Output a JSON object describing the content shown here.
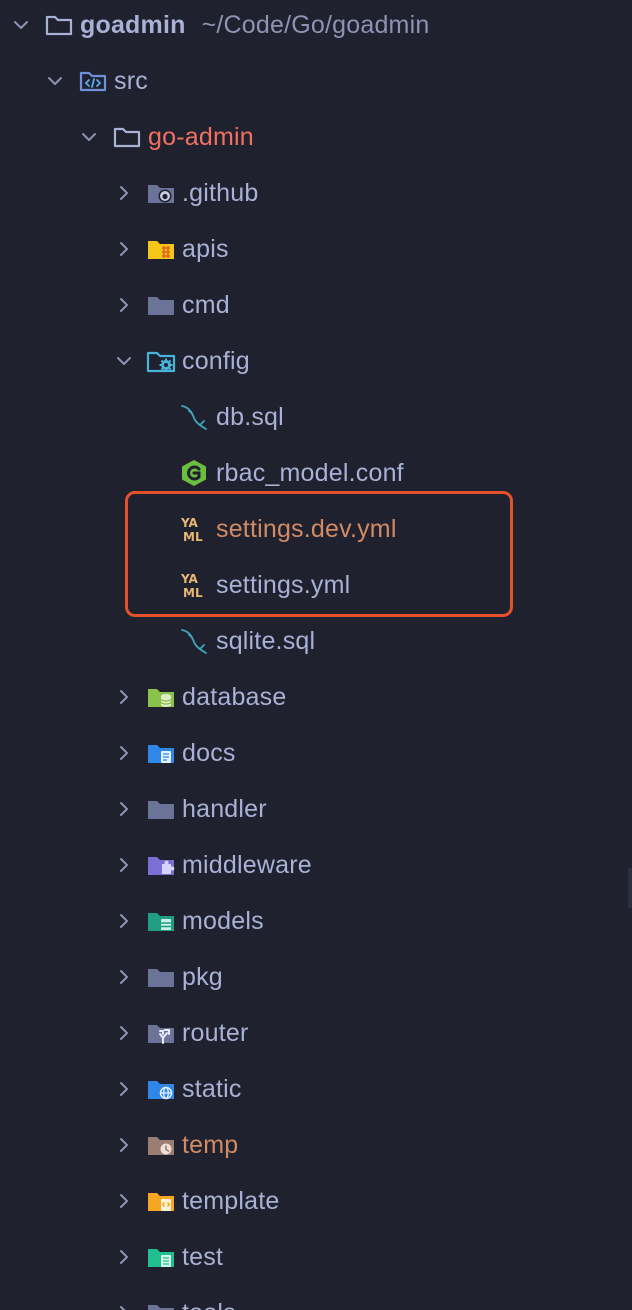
{
  "root": {
    "name": "goadmin",
    "path": "~/Code/Go/goadmin"
  },
  "src": {
    "label": "src"
  },
  "goadmin_pkg": {
    "label": "go-admin"
  },
  "folders_top": [
    {
      "label": ".github",
      "icon": "github-folder-icon"
    },
    {
      "label": "apis",
      "icon": "api-folder-icon"
    },
    {
      "label": "cmd",
      "icon": "folder-icon"
    }
  ],
  "config": {
    "label": "config",
    "files": [
      {
        "label": "db.sql",
        "icon": "mysql-dolphin-icon"
      },
      {
        "label": "rbac_model.conf",
        "icon": "go-g-icon"
      },
      {
        "label": "settings.dev.yml",
        "icon": "yaml-icon"
      },
      {
        "label": "settings.yml",
        "icon": "yaml-icon"
      },
      {
        "label": "sqlite.sql",
        "icon": "mysql-dolphin-icon"
      }
    ]
  },
  "folders_bottom": [
    {
      "label": "database",
      "icon": "database-folder-icon"
    },
    {
      "label": "docs",
      "icon": "docs-folder-icon"
    },
    {
      "label": "handler",
      "icon": "folder-icon"
    },
    {
      "label": "middleware",
      "icon": "middleware-folder-icon"
    },
    {
      "label": "models",
      "icon": "models-folder-icon"
    },
    {
      "label": "pkg",
      "icon": "folder-icon"
    },
    {
      "label": "router",
      "icon": "router-folder-icon"
    },
    {
      "label": "static",
      "icon": "static-folder-icon"
    },
    {
      "label": "temp",
      "icon": "temp-folder-icon"
    },
    {
      "label": "template",
      "icon": "template-folder-icon"
    },
    {
      "label": "test",
      "icon": "test-folder-icon"
    },
    {
      "label": "tools",
      "icon": "tools-folder-icon"
    }
  ],
  "colors": {
    "background": "#1f212e",
    "text": "#a9b1d6",
    "modified": "#f27062",
    "changed": "#d28b63",
    "highlight_border": "#e4512b"
  }
}
